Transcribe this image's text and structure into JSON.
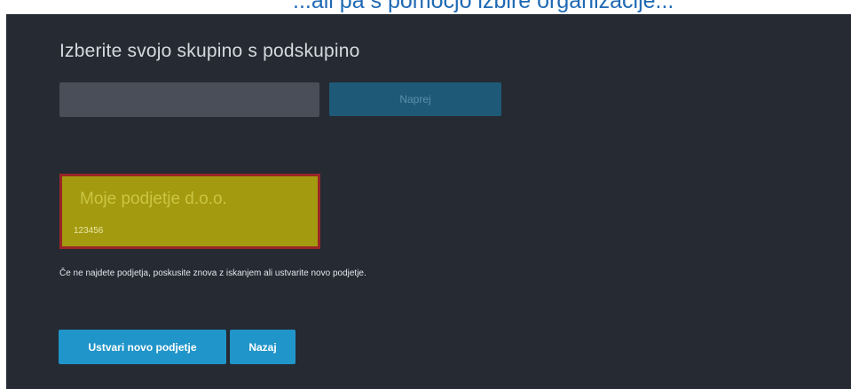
{
  "top_caption": "...ali pa s pomočjo izbire organizacije...",
  "form": {
    "heading": "Izberite svojo skupino s podskupino",
    "group_input_value": "",
    "next_label": "Naprej"
  },
  "result": {
    "company_name": "Moje podjetje d.o.o.",
    "company_id": "123456"
  },
  "hint": "Če ne najdete podjetja, poskusite znova z iskanjem ali ustvarite novo podjetje.",
  "actions": {
    "create_label": "Ustvari novo podjetje",
    "back_label": "Nazaj"
  },
  "colors": {
    "panel_bg": "#252a33",
    "accent_button": "#2095c9",
    "highlight_card": "#a39a10",
    "highlight_border": "#9b2626"
  }
}
